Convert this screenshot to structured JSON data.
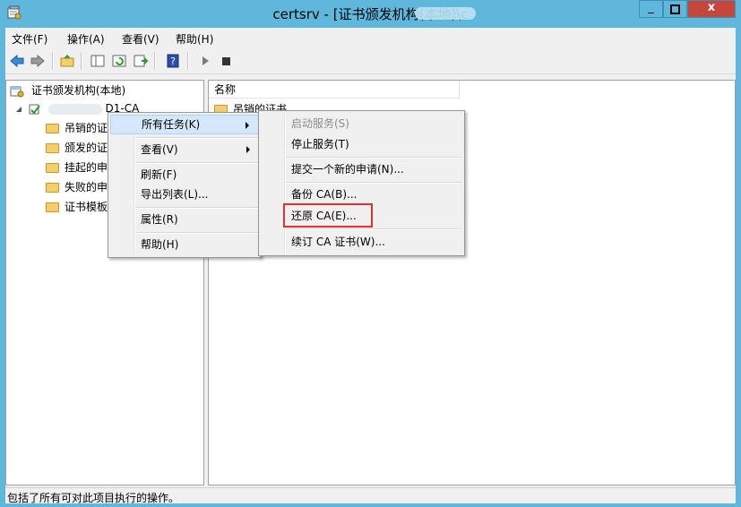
{
  "window": {
    "title": "certsrv - [证书颁发机构(本地)\\c",
    "controls": [
      "_",
      "□",
      "x"
    ]
  },
  "menubar": [
    {
      "label": "文件(F)"
    },
    {
      "label": "操作(A)"
    },
    {
      "label": "查看(V)"
    },
    {
      "label": "帮助(H)"
    }
  ],
  "toolbar": {
    "icons": [
      "back-arrow-icon",
      "forward-arrow-icon",
      "up-folder-icon",
      "show-hide-tree-icon",
      "refresh-icon",
      "export-list-icon",
      "help-icon",
      "play-icon",
      "stop-icon"
    ]
  },
  "tree": {
    "root": "证书颁发机构(本地)",
    "ca_node": "D1-CA",
    "children": [
      {
        "label": "吊销的证"
      },
      {
        "label": "颁发的证"
      },
      {
        "label": "挂起的申"
      },
      {
        "label": "失败的申"
      },
      {
        "label": "证书模板"
      }
    ]
  },
  "list": {
    "column_name": "名称",
    "rows": [
      "吊销的证书"
    ]
  },
  "context_menu": {
    "items": [
      {
        "label": "所有任务(K)",
        "submenu": true,
        "highlighted": true
      },
      {
        "label": "查看(V)",
        "submenu": true
      },
      {
        "label": "刷新(F)"
      },
      {
        "label": "导出列表(L)..."
      },
      {
        "label": "属性(R)"
      },
      {
        "label": "帮助(H)"
      }
    ]
  },
  "submenu": {
    "items": [
      {
        "label": "启动服务(S)",
        "disabled": true
      },
      {
        "label": "停止服务(T)"
      },
      {
        "label": "提交一个新的申请(N)..."
      },
      {
        "label": "备份 CA(B)..."
      },
      {
        "label": "还原 CA(E)...",
        "annotated": true
      },
      {
        "label": "续订 CA 证书(W)..."
      }
    ]
  },
  "status": "包括了所有可对此项目执行的操作。",
  "colors": {
    "titlebar": "#5fb7dc",
    "close_button": "#c7463c",
    "annotation": "#e3302f",
    "menu_hover": "#d5e8fb"
  }
}
